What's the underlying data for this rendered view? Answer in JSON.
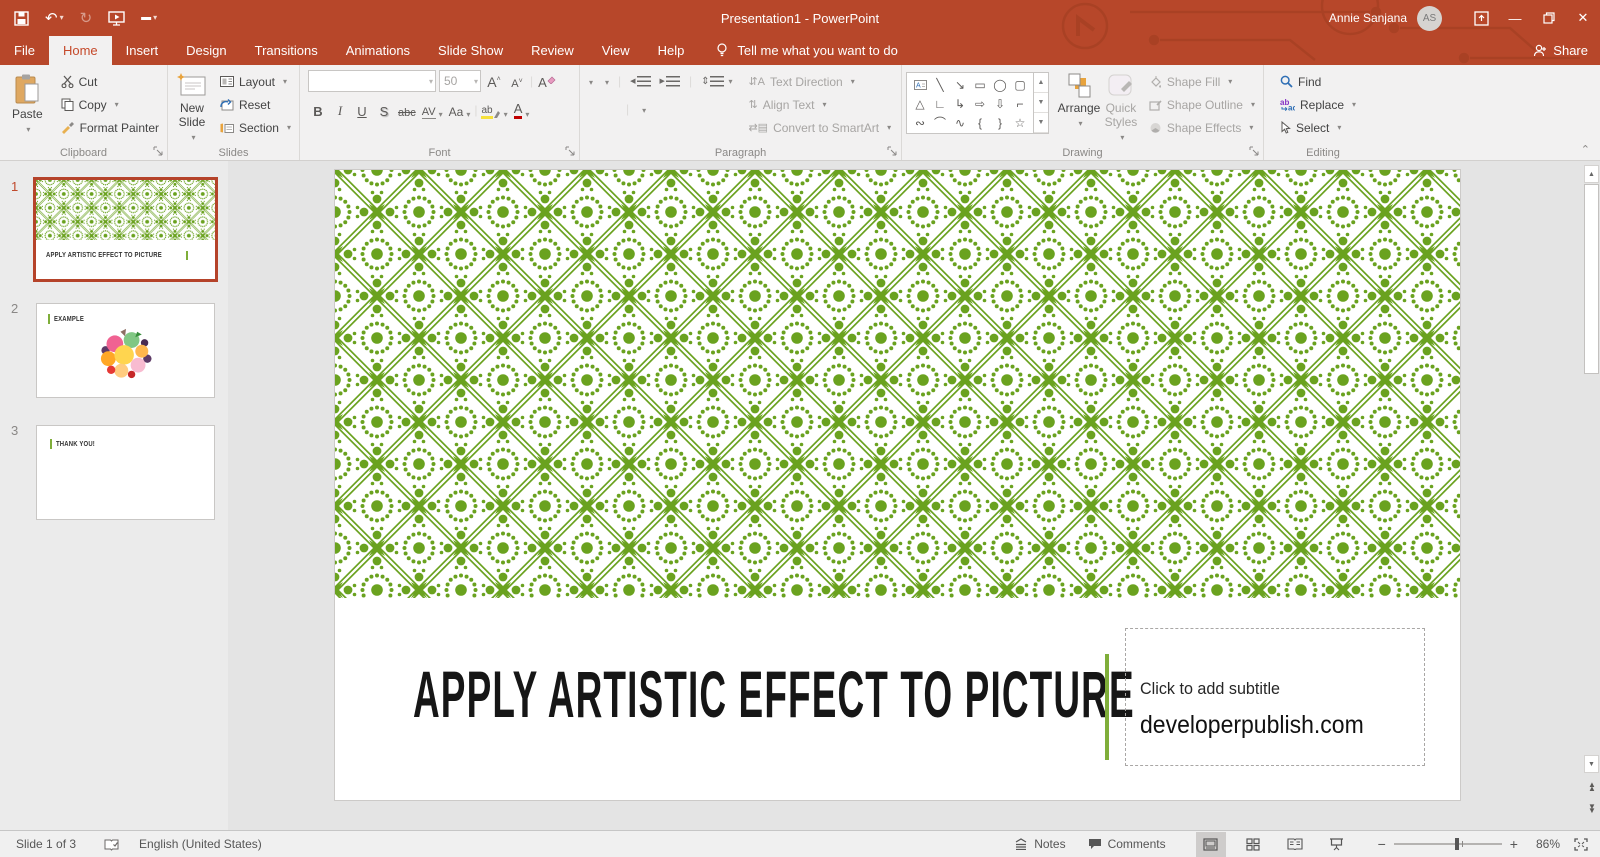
{
  "titlebar": {
    "title": "Presentation1 - PowerPoint",
    "user_name": "Annie Sanjana",
    "avatar_initials": "AS"
  },
  "tabs": {
    "items": [
      "File",
      "Home",
      "Insert",
      "Design",
      "Transitions",
      "Animations",
      "Slide Show",
      "Review",
      "View",
      "Help"
    ],
    "active": "Home",
    "tell_me": "Tell me what you want to do",
    "share": "Share"
  },
  "ribbon": {
    "clipboard": {
      "label": "Clipboard",
      "paste": "Paste",
      "cut": "Cut",
      "copy": "Copy",
      "format_painter": "Format Painter"
    },
    "slides": {
      "label": "Slides",
      "new_slide": "New Slide",
      "layout": "Layout",
      "reset": "Reset",
      "section": "Section"
    },
    "font": {
      "label": "Font",
      "font_size": "50",
      "grow": "A",
      "shrink": "A",
      "clear": "A",
      "bold": "B",
      "italic": "I",
      "underline": "U",
      "shadow": "S",
      "strikethrough": "abc",
      "char_spacing": "AV",
      "change_case": "Aa",
      "highlight": "ab",
      "font_color": "A"
    },
    "paragraph": {
      "label": "Paragraph",
      "text_direction": "Text Direction",
      "align_text": "Align Text",
      "smartart": "Convert to SmartArt"
    },
    "drawing": {
      "label": "Drawing",
      "arrange": "Arrange",
      "quick_styles": "Quick Styles",
      "shape_fill": "Shape Fill",
      "shape_outline": "Shape Outline",
      "shape_effects": "Shape Effects"
    },
    "editing": {
      "label": "Editing",
      "find": "Find",
      "replace": "Replace",
      "select": "Select"
    }
  },
  "icons": {
    "undo": "↶",
    "redo": "↻",
    "shapes": [
      "╲",
      "↘",
      "▭",
      "◯",
      "▢",
      "△",
      "∟",
      "↳",
      "⇨",
      "⇩",
      "⌐",
      "∾",
      "⌒",
      "∿",
      "{",
      "}",
      "☆"
    ]
  },
  "slides_panel": [
    {
      "num": "1",
      "title": "APPLY ARTISTIC EFFECT TO PICTURE"
    },
    {
      "num": "2",
      "title": "EXAMPLE"
    },
    {
      "num": "3",
      "title": "THANK YOU!"
    }
  ],
  "slide": {
    "title": "APPLY ARTISTIC EFFECT TO PICTURE",
    "subtitle_placeholder": "Click to add subtitle",
    "subtitle_text": "developerpublish.com"
  },
  "statusbar": {
    "slide_indicator": "Slide 1 of 3",
    "language": "English (United States)",
    "notes": "Notes",
    "comments": "Comments",
    "zoom_level": "86%"
  },
  "colors": {
    "titlebar_red": "#b7472a",
    "ribbon_bg": "#f2f1f1",
    "pattern_green": "#6aa21f",
    "accent_green": "#7fae3a",
    "selected_thumb_border": "#b5432a"
  }
}
